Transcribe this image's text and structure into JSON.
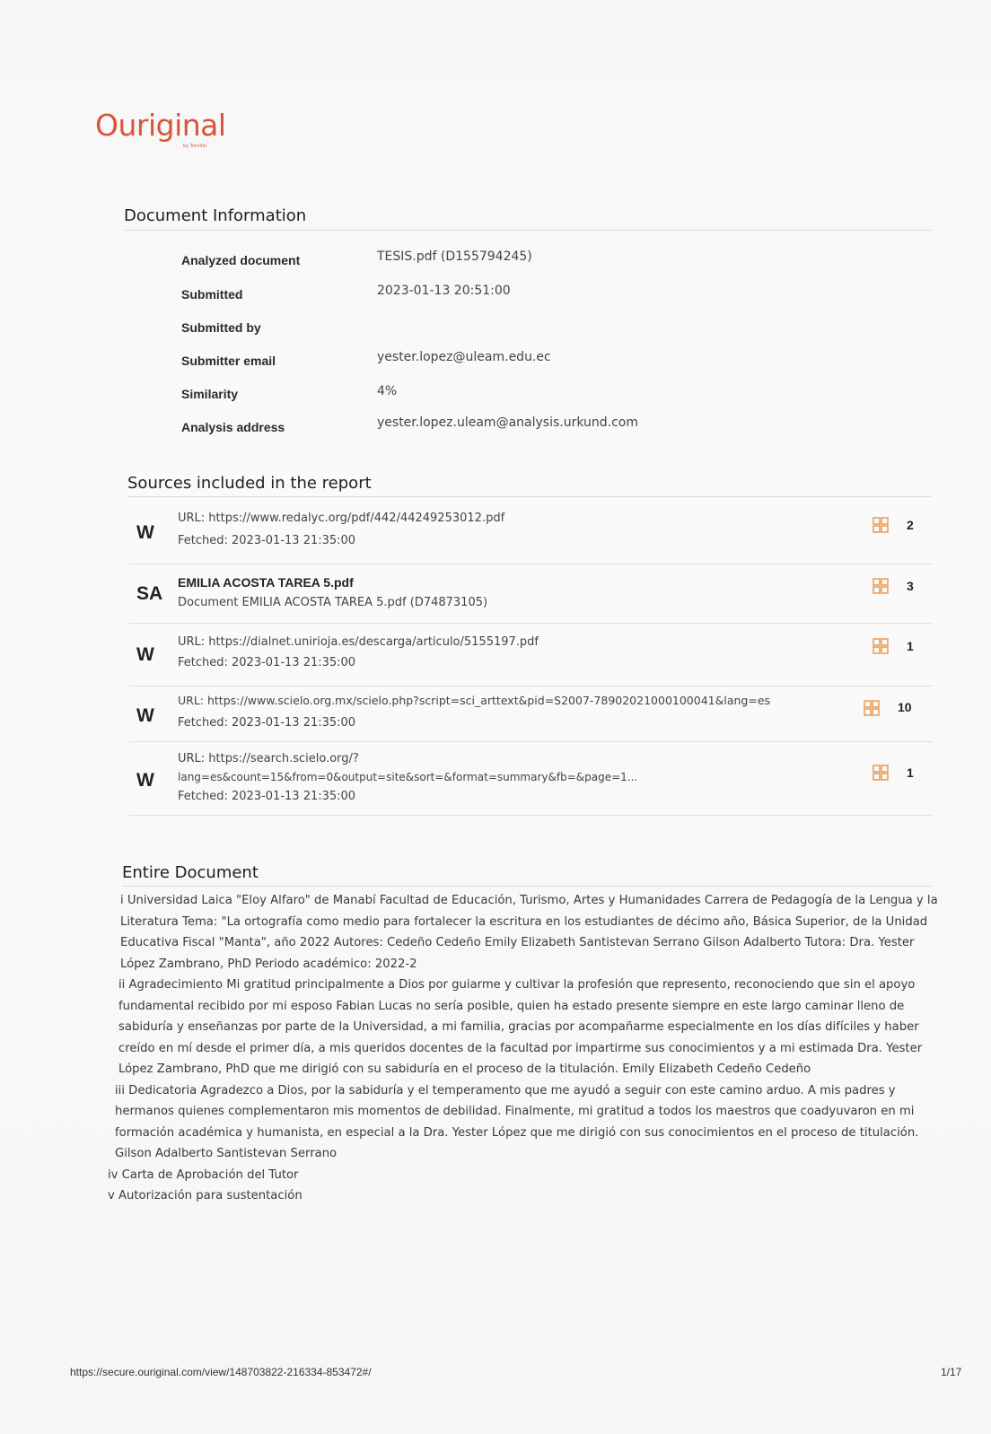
{
  "brand": {
    "name": "Ouriginal",
    "sub": "by Turnitin"
  },
  "document_information": {
    "title": "Document Information",
    "rows": [
      {
        "label": "Analyzed document",
        "value": "TESIS.pdf (D155794245)"
      },
      {
        "label": "Submitted",
        "value": "2023-01-13 20:51:00"
      },
      {
        "label": "Submitted by",
        "value": ""
      },
      {
        "label": "Submitter email",
        "value": "yester.lopez@uleam.edu.ec"
      },
      {
        "label": "Similarity",
        "value": "4%"
      },
      {
        "label": "Analysis address",
        "value": "yester.lopez.uleam@analysis.urkund.com"
      }
    ]
  },
  "sources": {
    "title": "Sources included in the report",
    "items": [
      {
        "type": "W",
        "line1": "URL: https://www.redalyc.org/pdf/442/44249253012.pdf",
        "line2": "Fetched: 2023-01-13 21:35:00",
        "line3": "",
        "count": "2"
      },
      {
        "type": "SA",
        "line1": "EMILIA ACOSTA TAREA 5.pdf",
        "line2": "Document EMILIA ACOSTA TAREA 5.pdf (D74873105)",
        "line3": "",
        "count": "3"
      },
      {
        "type": "W",
        "line1": "URL: https://dialnet.unirioja.es/descarga/articulo/5155197.pdf",
        "line2": "Fetched: 2023-01-13 21:35:00",
        "line3": "",
        "count": "1"
      },
      {
        "type": "W",
        "line1": "URL: https://www.scielo.org.mx/scielo.php?script=sci_arttext&pid=S2007-78902021000100041&lang=es",
        "line2": "Fetched: 2023-01-13 21:35:00",
        "line3": "",
        "count": "10"
      },
      {
        "type": "W",
        "line1": "URL: https://search.scielo.org/?",
        "line2": "lang=es&count=15&from=0&output=site&sort=&format=summary&fb=&page=1...",
        "line3": "Fetched: 2023-01-13 21:35:00",
        "count": "1"
      }
    ]
  },
  "entire_document": {
    "title": "Entire Document",
    "paragraphs": [
      "i Universidad Laica \"Eloy Alfaro\" de Manabí Facultad de Educación, Turismo, Artes y Humanidades Carrera de Pedagogía de la Lengua y la Literatura Tema: \"La ortografía como medio para fortalecer la escritura en los estudiantes de décimo año, Básica Superior, de la Unidad Educativa Fiscal \"Manta\", año 2022 Autores: Cedeño Cedeño Emily Elizabeth Santistevan Serrano Gilson Adalberto Tutora: Dra. Yester López Zambrano, PhD Periodo académico: 2022-2",
      "ii Agradecimiento Mi gratitud principalmente a Dios por guiarme y cultivar la profesión que represento, reconociendo que sin el apoyo fundamental recibido por mi esposo Fabian Lucas no sería posible, quien ha estado presente siempre en este largo caminar lleno de sabiduría y enseñanzas por parte de la Universidad, a mi familia, gracias por acompañarme especialmente en los días difíciles y haber creído en mí desde el primer día, a mis queridos docentes de la facultad por impartirme sus conocimientos y a mi estimada Dra. Yester López Zambrano, PhD que me dirigió con su sabiduría en el proceso de la titulación. Emily Elizabeth Cedeño Cedeño",
      "iii Dedicatoria Agradezco a Dios, por la sabiduría y el temperamento que me ayudó a seguir con este camino arduo. A mis padres y hermanos quienes complementaron mis momentos de debilidad. Finalmente, mi gratitud a todos los maestros que coadyuvaron en mi formación académica y humanista, en especial a la Dra. Yester López que me dirigió con sus conocimientos en el proceso de titulación. Gilson Adalberto Santistevan Serrano",
      "iv Carta de Aprobación del Tutor",
      "v Autorización para sustentación"
    ]
  },
  "footer": {
    "url": "https://secure.ouriginal.com/view/148703822-216334-853472#/",
    "page": "1/17"
  },
  "colors": {
    "brand": "#d9553a",
    "icon": "#e8a15a"
  }
}
